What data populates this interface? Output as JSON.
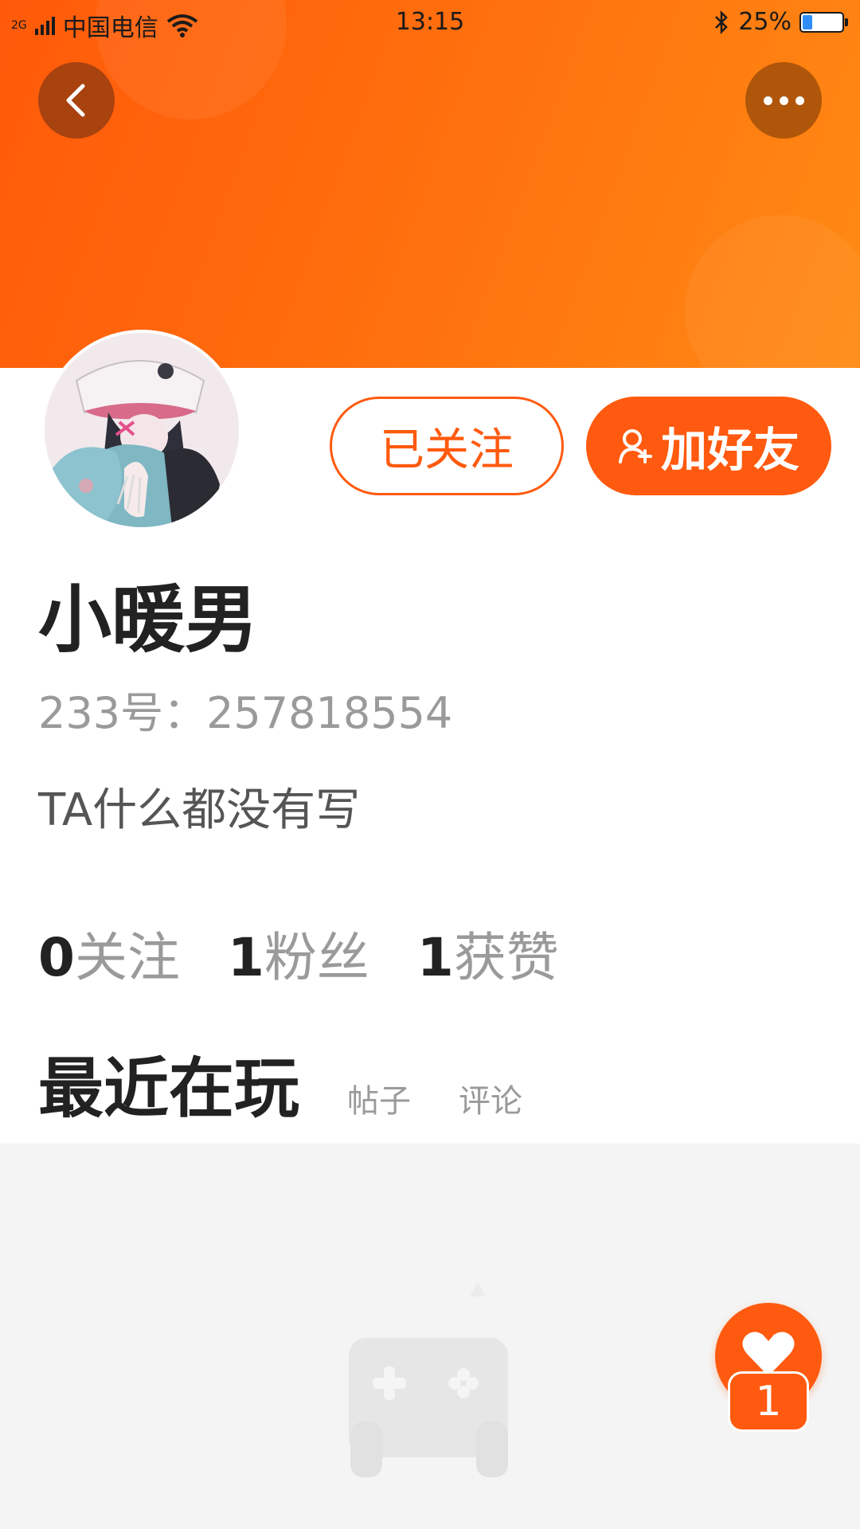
{
  "status_bar": {
    "network": "2G",
    "carrier": "中国电信",
    "time": "13:15",
    "battery_percent": "25%",
    "battery_level": 0.25,
    "icons": [
      "signal-icon",
      "wifi-icon",
      "bluetooth-icon",
      "battery-icon"
    ]
  },
  "header": {
    "back_icon": "chevron-left-icon",
    "more_icon": "more-horizontal-icon",
    "banner_color": "#ff6a0d"
  },
  "profile": {
    "avatar": "anime-avatar",
    "followed_label": "已关注",
    "add_friend_label": "加好友",
    "add_friend_icon": "user-plus-icon",
    "name": "小暖男",
    "id_text": "233号：257818554",
    "bio": "TA什么都没有写"
  },
  "stats": [
    {
      "num": "0",
      "label": "关注"
    },
    {
      "num": "1",
      "label": "粉丝"
    },
    {
      "num": "1",
      "label": "获赞"
    }
  ],
  "tabs": {
    "active": "最近在玩",
    "posts": "帖子",
    "comments": "评论"
  },
  "fab": {
    "icon": "heart-icon",
    "count": "1"
  },
  "colors": {
    "accent": "#ff5a0f",
    "text_primary": "#222222",
    "text_secondary": "#9a9a9a"
  }
}
